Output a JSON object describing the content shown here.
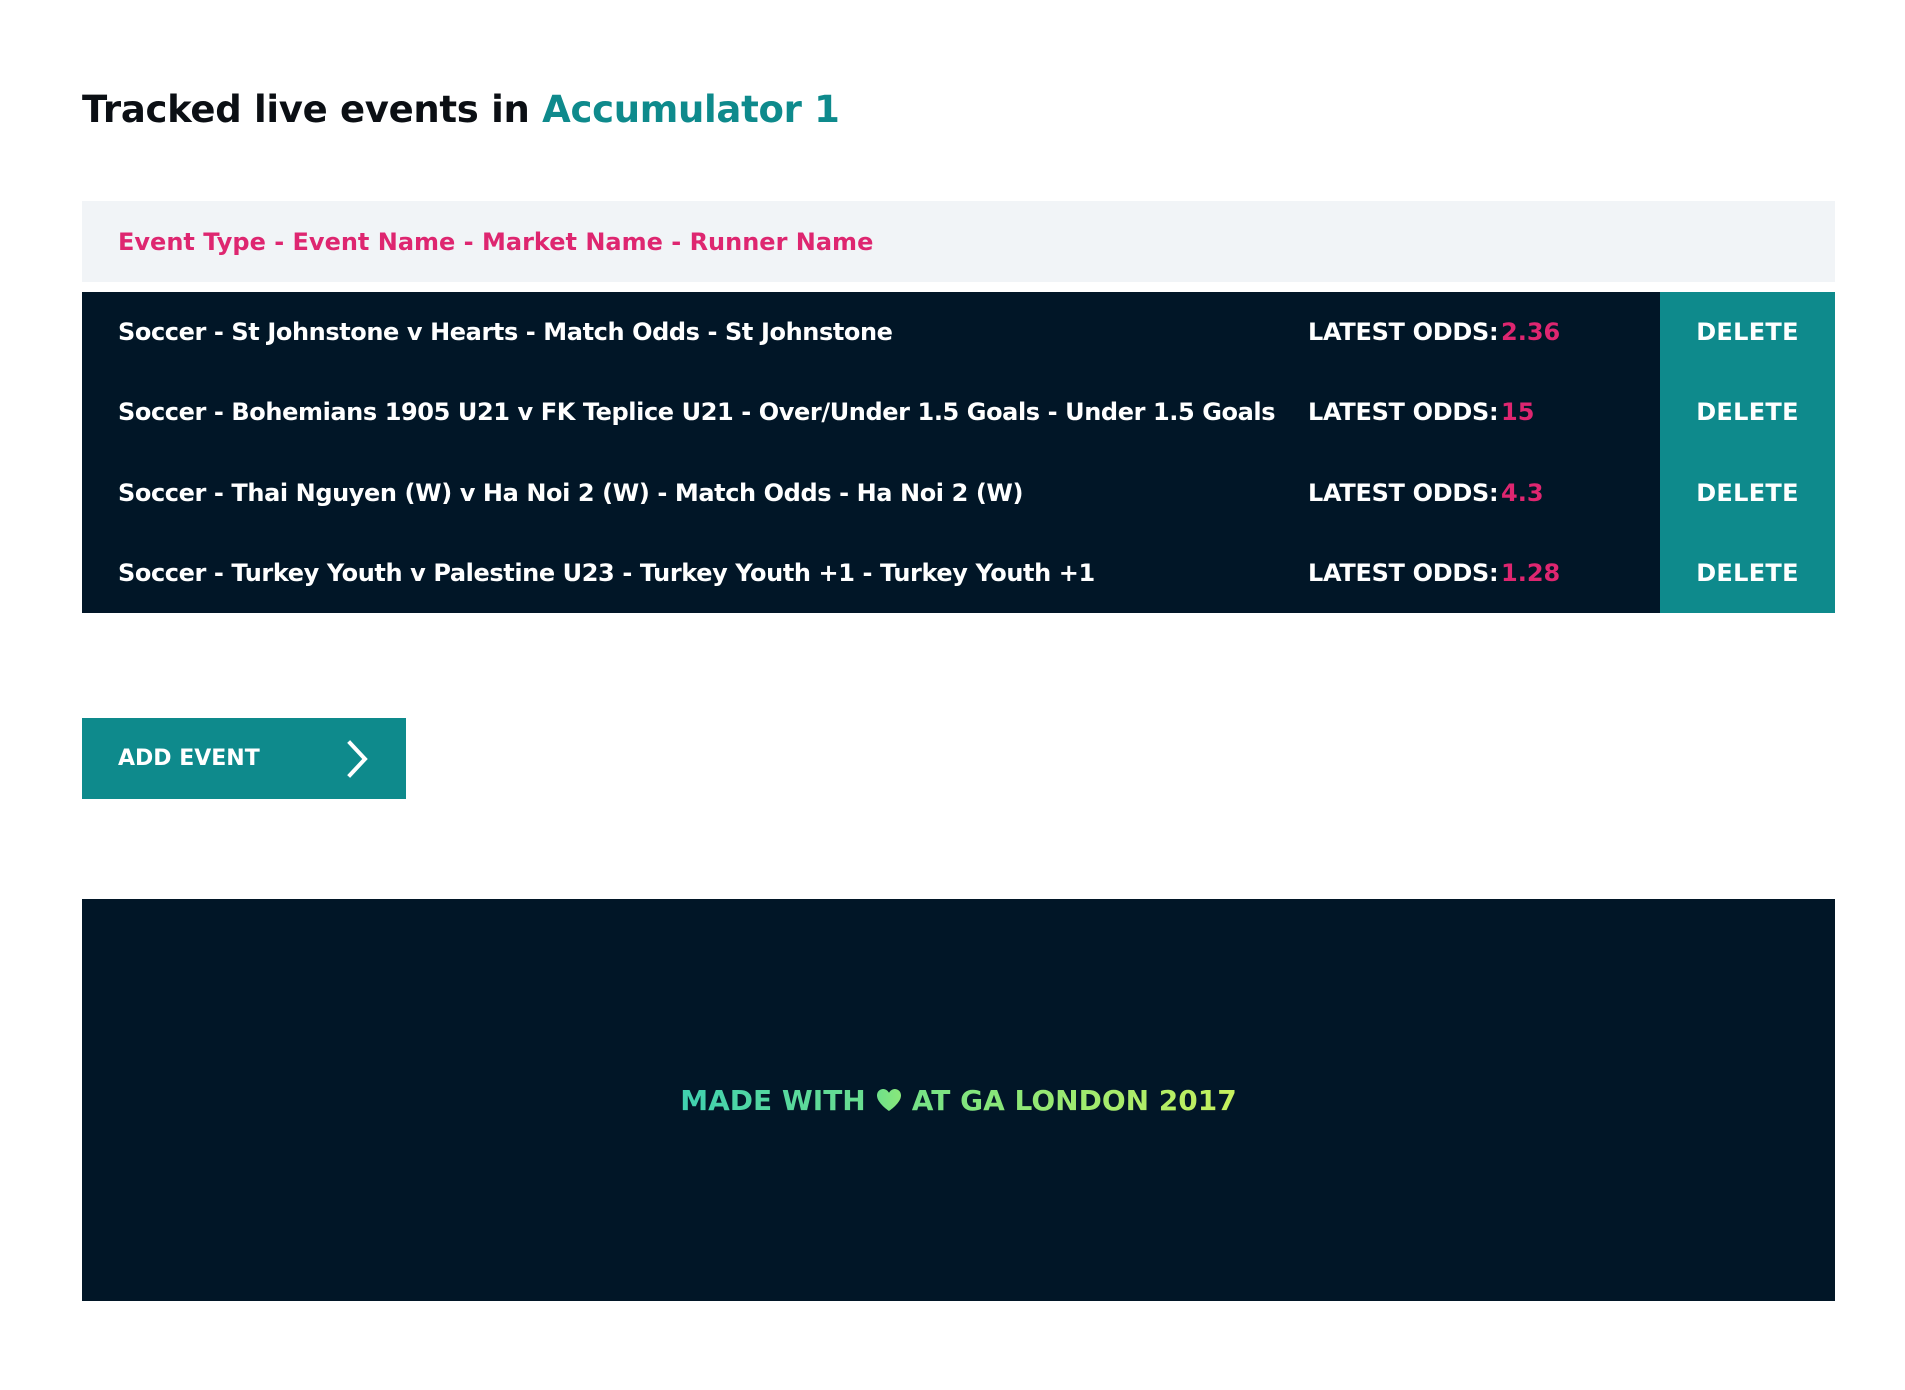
{
  "title": {
    "prefix": "Tracked live events in ",
    "accumulator": "Accumulator 1"
  },
  "table_header": "Event Type - Event Name - Market Name - Runner Name",
  "odds_label": "LATEST ODDS:",
  "delete_label": "DELETE",
  "events": [
    {
      "name": "Soccer - St Johnstone v Hearts - Match Odds - St Johnstone",
      "odds": "2.36"
    },
    {
      "name": "Soccer - Bohemians 1905 U21 v FK Teplice U21 - Over/Under 1.5 Goals - Under 1.5 Goals",
      "odds": "15"
    },
    {
      "name": "Soccer - Thai Nguyen (W) v Ha Noi 2 (W) - Match Odds - Ha Noi 2 (W)",
      "odds": "4.3"
    },
    {
      "name": "Soccer - Turkey Youth v Palestine U23 - Turkey Youth +1 - Turkey Youth +1",
      "odds": "1.28"
    }
  ],
  "add_button": {
    "label": "ADD EVENT",
    "icon": "chevron-right-icon"
  },
  "footer": {
    "before": "MADE WITH",
    "icon": "heart-icon",
    "after": "AT GA LONDON 2017"
  },
  "colors": {
    "accent_teal": "#0e8a8c",
    "accent_pink": "#de2670",
    "dark_navy": "#011627",
    "header_bg": "#f1f4f7"
  }
}
